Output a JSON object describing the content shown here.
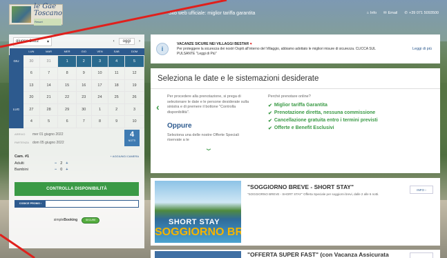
{
  "header": {
    "logo_line1": "le Gae",
    "logo_line2": "Toscano",
    "logo_small": "Resort",
    "tagline": "Sito web ufficiale: miglior tariffa garantita",
    "links": {
      "info": "Info",
      "email": "Email",
      "phone": "+39 071 5093500"
    }
  },
  "calendar": {
    "month_label": "giugno 2022",
    "today_label": "oggi",
    "weekdays": [
      "LUN",
      "MAR",
      "MER",
      "GIO",
      "VEN",
      "SAB",
      "DOM"
    ],
    "weeks": [
      {
        "label": "GIU",
        "days": [
          "30",
          "31",
          "1",
          "2",
          "3",
          "4",
          "5"
        ]
      },
      {
        "label": "",
        "days": [
          "6",
          "7",
          "8",
          "9",
          "10",
          "11",
          "12"
        ]
      },
      {
        "label": "",
        "days": [
          "13",
          "14",
          "15",
          "16",
          "17",
          "18",
          "19"
        ]
      },
      {
        "label": "",
        "days": [
          "20",
          "21",
          "22",
          "23",
          "24",
          "25",
          "26"
        ]
      },
      {
        "label": "LUG",
        "days": [
          "27",
          "28",
          "29",
          "30",
          "1",
          "2",
          "3"
        ]
      },
      {
        "label": "",
        "days": [
          "4",
          "5",
          "6",
          "7",
          "8",
          "9",
          "10"
        ]
      }
    ]
  },
  "stay": {
    "arrival_label": "ARRIVO",
    "arrival_value": "mer 01 giugno 2022",
    "departure_label": "PARTENZA",
    "departure_value": "dom 05 giugno 2022",
    "nights_count": "4",
    "nights_label": "NOTTI"
  },
  "rooms": {
    "room_label": "Cam. #1",
    "add_room": "+ AGGIUNGI CAMERA",
    "adults_label": "Adulti",
    "adults_value": "2",
    "children_label": "Bambini",
    "children_value": "0"
  },
  "check_button": "CONTROLLA DISPONIBILITÀ",
  "promo_label": "CODICE PROMO",
  "powered": {
    "simple": "simple",
    "booking": "Booking",
    "secure": "SECURE"
  },
  "info_banner": {
    "title": "VACANZE SICURE NEI VILLAGGI BESTAR",
    "body": "Per proteggere la sicurezza dei nostri Ospiti all'interno del Villaggio, abbiamo adottato le migliori misure di sicurezza. CLICCA SUL PULSANTE \"Leggi di Più\"",
    "link": "Leggi di più"
  },
  "select": {
    "title": "Seleziona le date e le sistemazioni desiderate",
    "instructions": "Per procedere alla prenotazione, si prega di selezionare le date e le persone desiderate sulla sinistra e di premere il bottone \"Controlla disponibilità\".",
    "oppure": "Oppure",
    "offers_hint": "Seleziona una delle nostre Offerte Speciali riservate a te",
    "why_title": "Perché prenotare online?",
    "benefits": [
      "Miglior tariffa Garantita",
      "Prenotazione diretta, nessuna commissione",
      "Cancellazione gratuita entro i termini previsti",
      "Offerte e Benefit Esclusivi"
    ]
  },
  "offers": [
    {
      "title": "\"SOGGIORNO BREVE - SHORT STAY\"",
      "description": "\"SOGGIORNO BREVE - SHORT STAY\" Offerta Speciale per soggiorni brevi, dalle 2 alle 6 notti.",
      "image_text1": "SHORT STAY",
      "image_text2": "SOGGIORNO BREVE",
      "button": "INFO"
    },
    {
      "title": "\"OFFERTA SUPER FAST\" (con Vacanza Assicurata"
    }
  ]
}
